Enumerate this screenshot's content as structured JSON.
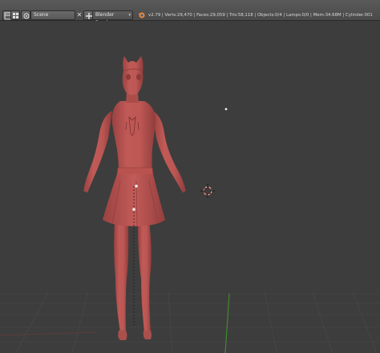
{
  "header": {
    "scene_value": "Scene",
    "scene_close": "✕",
    "renderer_value": "Blender Render",
    "renderer_arrow": "▾",
    "stats": "v2.79 | Verts:29,470 | Faces:29,059 | Tris:58,118 | Objects:0/4 | Lamps:0/0 | Mem:34.68M | Cylinder.001"
  },
  "icons": {
    "editor": "screen-layout-icon",
    "add_scene": "add-icon",
    "info": "blender-logo-icon",
    "light": "lamp-point-icon",
    "camera": "camera-icon",
    "cursor": "3d-cursor-icon"
  },
  "colors": {
    "viewport_bg": "#3d3d3d",
    "header_bg": "#4f4f4f",
    "model": "#b55552",
    "grid": "#454545",
    "axis_green": "#3f8a2e",
    "axis_red": "#8a3232"
  }
}
